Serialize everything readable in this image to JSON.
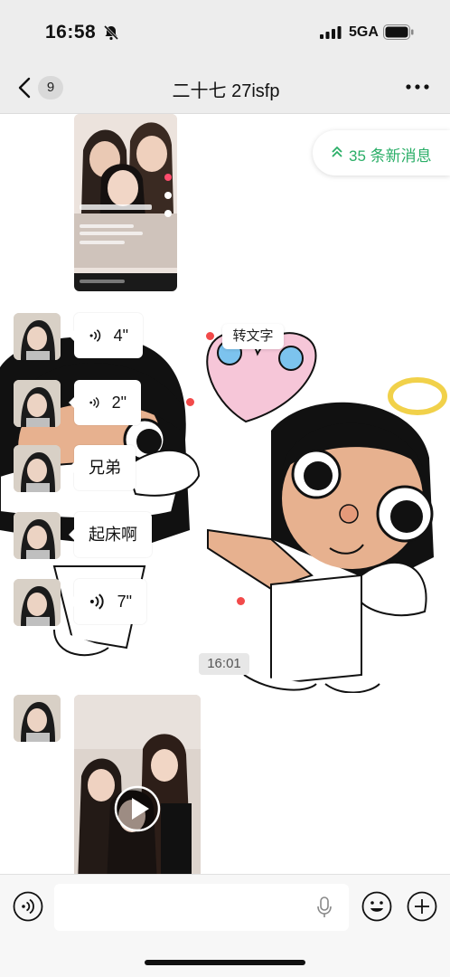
{
  "status_bar": {
    "time": "16:58",
    "network": "5GA",
    "icons": [
      "bell-slash-icon",
      "signal-icon",
      "battery-icon"
    ]
  },
  "nav": {
    "unread_count": "9",
    "title": "二十七 27isfp",
    "icons": [
      "back-chevron-icon",
      "more-icon"
    ]
  },
  "new_messages_pill": {
    "label": "35 条新消息",
    "color": "#2aae67",
    "icon": "double-chevron-up-icon"
  },
  "messages": [
    {
      "type": "video",
      "thumbnail": "video-screenshot"
    },
    {
      "type": "voice",
      "duration": "4\""
    },
    {
      "type": "voice",
      "duration": "2\""
    },
    {
      "type": "text",
      "text": "兄弟"
    },
    {
      "type": "text",
      "text": "起床啊"
    },
    {
      "type": "voice",
      "duration": "7\""
    },
    {
      "type": "timestamp",
      "text": "16:01"
    },
    {
      "type": "video",
      "thumbnail": "video-with-play-button"
    }
  ],
  "transcribe_label": "转文字",
  "input_bar": {
    "icons": [
      "voice-mode-icon",
      "microphone-icon",
      "emoji-icon",
      "plus-icon"
    ]
  }
}
